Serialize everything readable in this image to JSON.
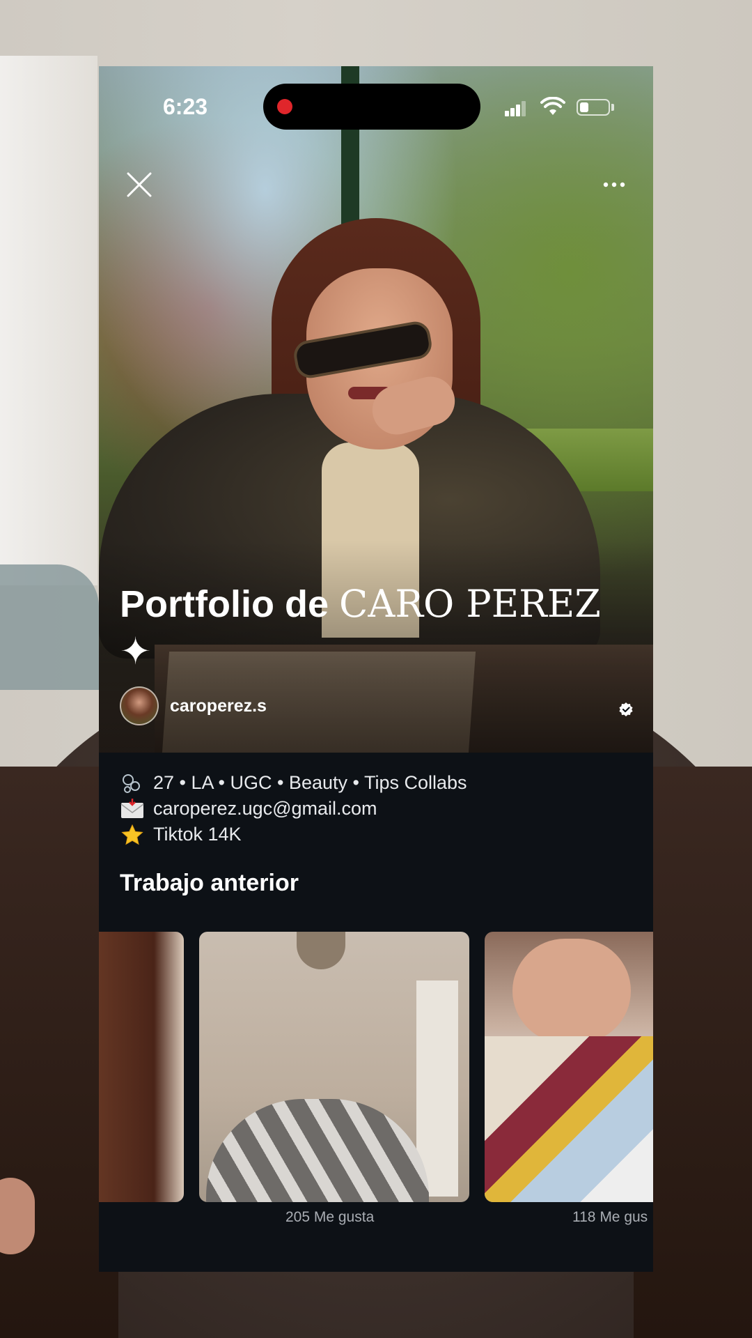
{
  "status_bar": {
    "time": "6:23"
  },
  "portfolio": {
    "title_bold": "Portfolio de",
    "title_name": "CARO PEREZ",
    "title_suffix": "✦",
    "username": "caroperez.s"
  },
  "bio": {
    "line1": "27 • LA • UGC • Beauty • Tips Collabs",
    "line2": "caroperez.ugc@gmail.com",
    "line3": "Tiktok 14K"
  },
  "previous_work": {
    "heading": "Trabajo anterior",
    "items": [
      {
        "likes": ""
      },
      {
        "likes": "205 Me gusta"
      },
      {
        "likes": "118 Me gus"
      }
    ]
  },
  "icons": {
    "close": "close-icon",
    "more": "more-horizontal-icon",
    "verified": "verified-badge-icon",
    "bio_line1": "bubbles-emoji",
    "bio_line2": "envelope-emoji",
    "bio_line3": "star-emoji"
  },
  "colors": {
    "panel_bg": "#0d1116",
    "text_primary": "#ffffff",
    "text_muted": "#a9adb3",
    "record_dot": "#e0262b"
  }
}
